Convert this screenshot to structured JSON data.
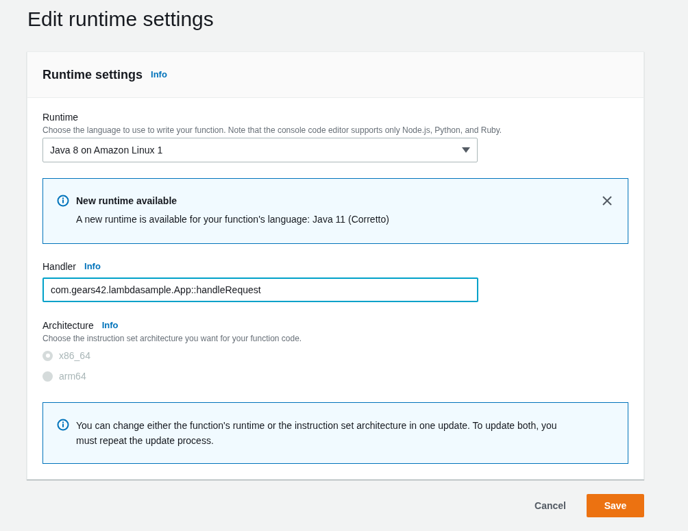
{
  "page_title": "Edit runtime settings",
  "panel": {
    "title": "Runtime settings",
    "info_link": "Info"
  },
  "runtime": {
    "label": "Runtime",
    "description": "Choose the language to use to write your function. Note that the console code editor supports only Node.js, Python, and Ruby.",
    "value": "Java 8 on Amazon Linux 1"
  },
  "runtime_alert": {
    "title": "New runtime available",
    "message": "A new runtime is available for your function's language: Java 11 (Corretto)",
    "dismissible": true
  },
  "handler": {
    "label": "Handler",
    "info_link": "Info",
    "value": "com.gears42.lambdasample.App::handleRequest",
    "focused": true
  },
  "architecture": {
    "label": "Architecture",
    "info_link": "Info",
    "description": "Choose the instruction set architecture you want for your function code.",
    "options": [
      {
        "label": "x86_64",
        "selected": true,
        "disabled": true
      },
      {
        "label": "arm64",
        "selected": false,
        "disabled": true
      }
    ]
  },
  "architecture_alert": {
    "message": "You can change either the function's runtime or the instruction set architecture in one update. To update both, you must repeat the update process."
  },
  "buttons": [
    {
      "label": "Cancel",
      "kind": "link"
    },
    {
      "label": "Save",
      "kind": "primary"
    }
  ]
}
